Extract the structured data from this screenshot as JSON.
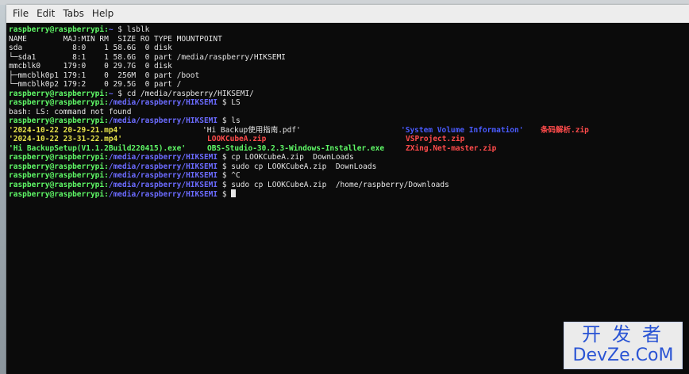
{
  "window": {
    "menu": [
      "File",
      "Edit",
      "Tabs",
      "Help"
    ]
  },
  "terminal": {
    "prompt_user": "raspberry@raspberrypi",
    "lines": [
      {
        "kind": "prompt",
        "path": "~",
        "cmd": "lsblk"
      },
      {
        "kind": "text",
        "text": "NAME        MAJ:MIN RM  SIZE RO TYPE MOUNTPOINT"
      },
      {
        "kind": "text",
        "text": "sda           8:0    1 58.6G  0 disk"
      },
      {
        "kind": "text",
        "text": "└─sda1        8:1    1 58.6G  0 part /media/raspberry/HIKSEMI"
      },
      {
        "kind": "text",
        "text": "mmcblk0     179:0    0 29.7G  0 disk"
      },
      {
        "kind": "text",
        "text": "├─mmcblk0p1 179:1    0  256M  0 part /boot"
      },
      {
        "kind": "text",
        "text": "└─mmcblk0p2 179:2    0 29.5G  0 part /"
      },
      {
        "kind": "prompt",
        "path": "~",
        "cmd": "cd /media/raspberry/HIKSEMI/"
      },
      {
        "kind": "prompt",
        "path": "/media/raspberry/HIKSEMI",
        "cmd": "LS"
      },
      {
        "kind": "text",
        "text": "bash: LS: command not found"
      },
      {
        "kind": "prompt",
        "path": "/media/raspberry/HIKSEMI",
        "cmd": "ls"
      },
      {
        "kind": "ls",
        "cells": [
          {
            "text": "'2024-10-22 20-29-21.mp4'",
            "type": "mp4",
            "col": 0
          },
          {
            "text": "'Hi Backup使用指南.pdf'",
            "type": "pdf",
            "col": 244
          },
          {
            "text": "'System Volume Information'",
            "type": "dir",
            "col": 494
          },
          {
            "text": "条码解析.zip",
            "type": "zip",
            "col": 670
          }
        ]
      },
      {
        "kind": "ls",
        "cells": [
          {
            "text": "'2024-10-22 23-31-22.mp4'",
            "type": "mp4",
            "col": 0
          },
          {
            "text": "LOOKCubeA.zip",
            "type": "zip",
            "col": 250
          },
          {
            "text": "VSProject.zip",
            "type": "zip",
            "col": 500
          }
        ]
      },
      {
        "kind": "ls",
        "cells": [
          {
            "text": "'Hi BackupSetup(V1.1.2Build220415).exe'",
            "type": "exe",
            "col": 0
          },
          {
            "text": "OBS-Studio-30.2.3-Windows-Installer.exe",
            "type": "exe",
            "col": 250
          },
          {
            "text": "ZXing.Net-master.zip",
            "type": "zip",
            "col": 500
          }
        ]
      },
      {
        "kind": "prompt",
        "path": "/media/raspberry/HIKSEMI",
        "cmd": "cp LOOKCubeA.zip  DownLoads"
      },
      {
        "kind": "prompt",
        "path": "/media/raspberry/HIKSEMI",
        "cmd": "sudo cp LOOKCubeA.zip  DownLoads"
      },
      {
        "kind": "prompt",
        "path": "/media/raspberry/HIKSEMI",
        "cmd": "^C"
      },
      {
        "kind": "prompt",
        "path": "/media/raspberry/HIKSEMI",
        "cmd": "sudo cp LOOKCubeA.zip  /home/raspberry/Downloads"
      },
      {
        "kind": "prompt",
        "path": "/media/raspberry/HIKSEMI",
        "cmd": "",
        "cursor": true
      }
    ]
  },
  "watermark": {
    "line1": "开发者",
    "line2": "DevZe.CoM"
  }
}
